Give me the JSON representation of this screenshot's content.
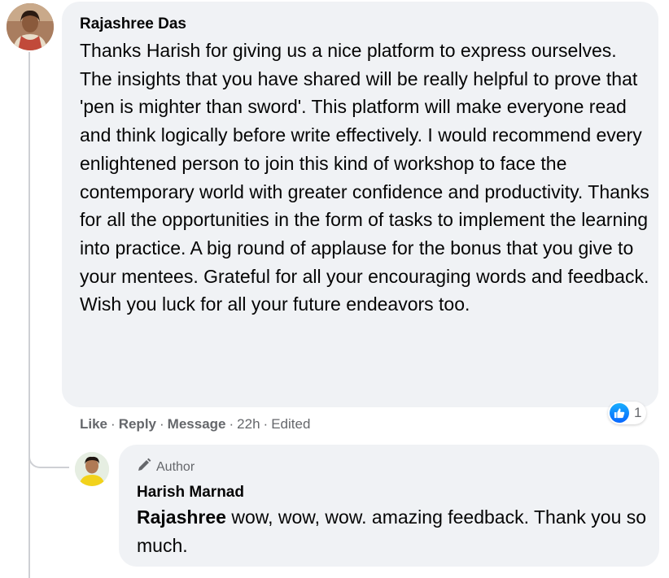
{
  "comment": {
    "author": "Rajashree Das",
    "text": "Thanks Harish for giving us a nice platform to express ourselves. The insights that you have shared will be really helpful to prove that 'pen is mighter than sword'. This platform will make everyone read and think logically before write effectively. I would recommend every enlightened person to join this kind of workshop to face the contemporary world with greater confidence and productivity. Thanks for all the opportunities in the form of tasks to implement the learning into practice. A big round of applause for the bonus that you give to your mentees. Grateful for all your encouraging words and feedback. Wish you luck for all your future endeavors too.",
    "reaction_count": "1",
    "actions": {
      "like": "Like",
      "reply": "Reply",
      "message": "Message",
      "time": "22h",
      "edited": "Edited",
      "separator": "·"
    }
  },
  "reply": {
    "badge": "Author",
    "author": "Harish Marnad",
    "mention": "Rajashree",
    "text": " wow, wow, wow. amazing feedback. Thank you so much."
  },
  "colors": {
    "bubble": "#f0f2f5",
    "secondary_text": "#65676b",
    "like_blue": "#0866ff",
    "thread_line": "#ced0d4"
  },
  "icons": {
    "like": "thumbs-up-icon",
    "badge": "pencil-icon"
  }
}
